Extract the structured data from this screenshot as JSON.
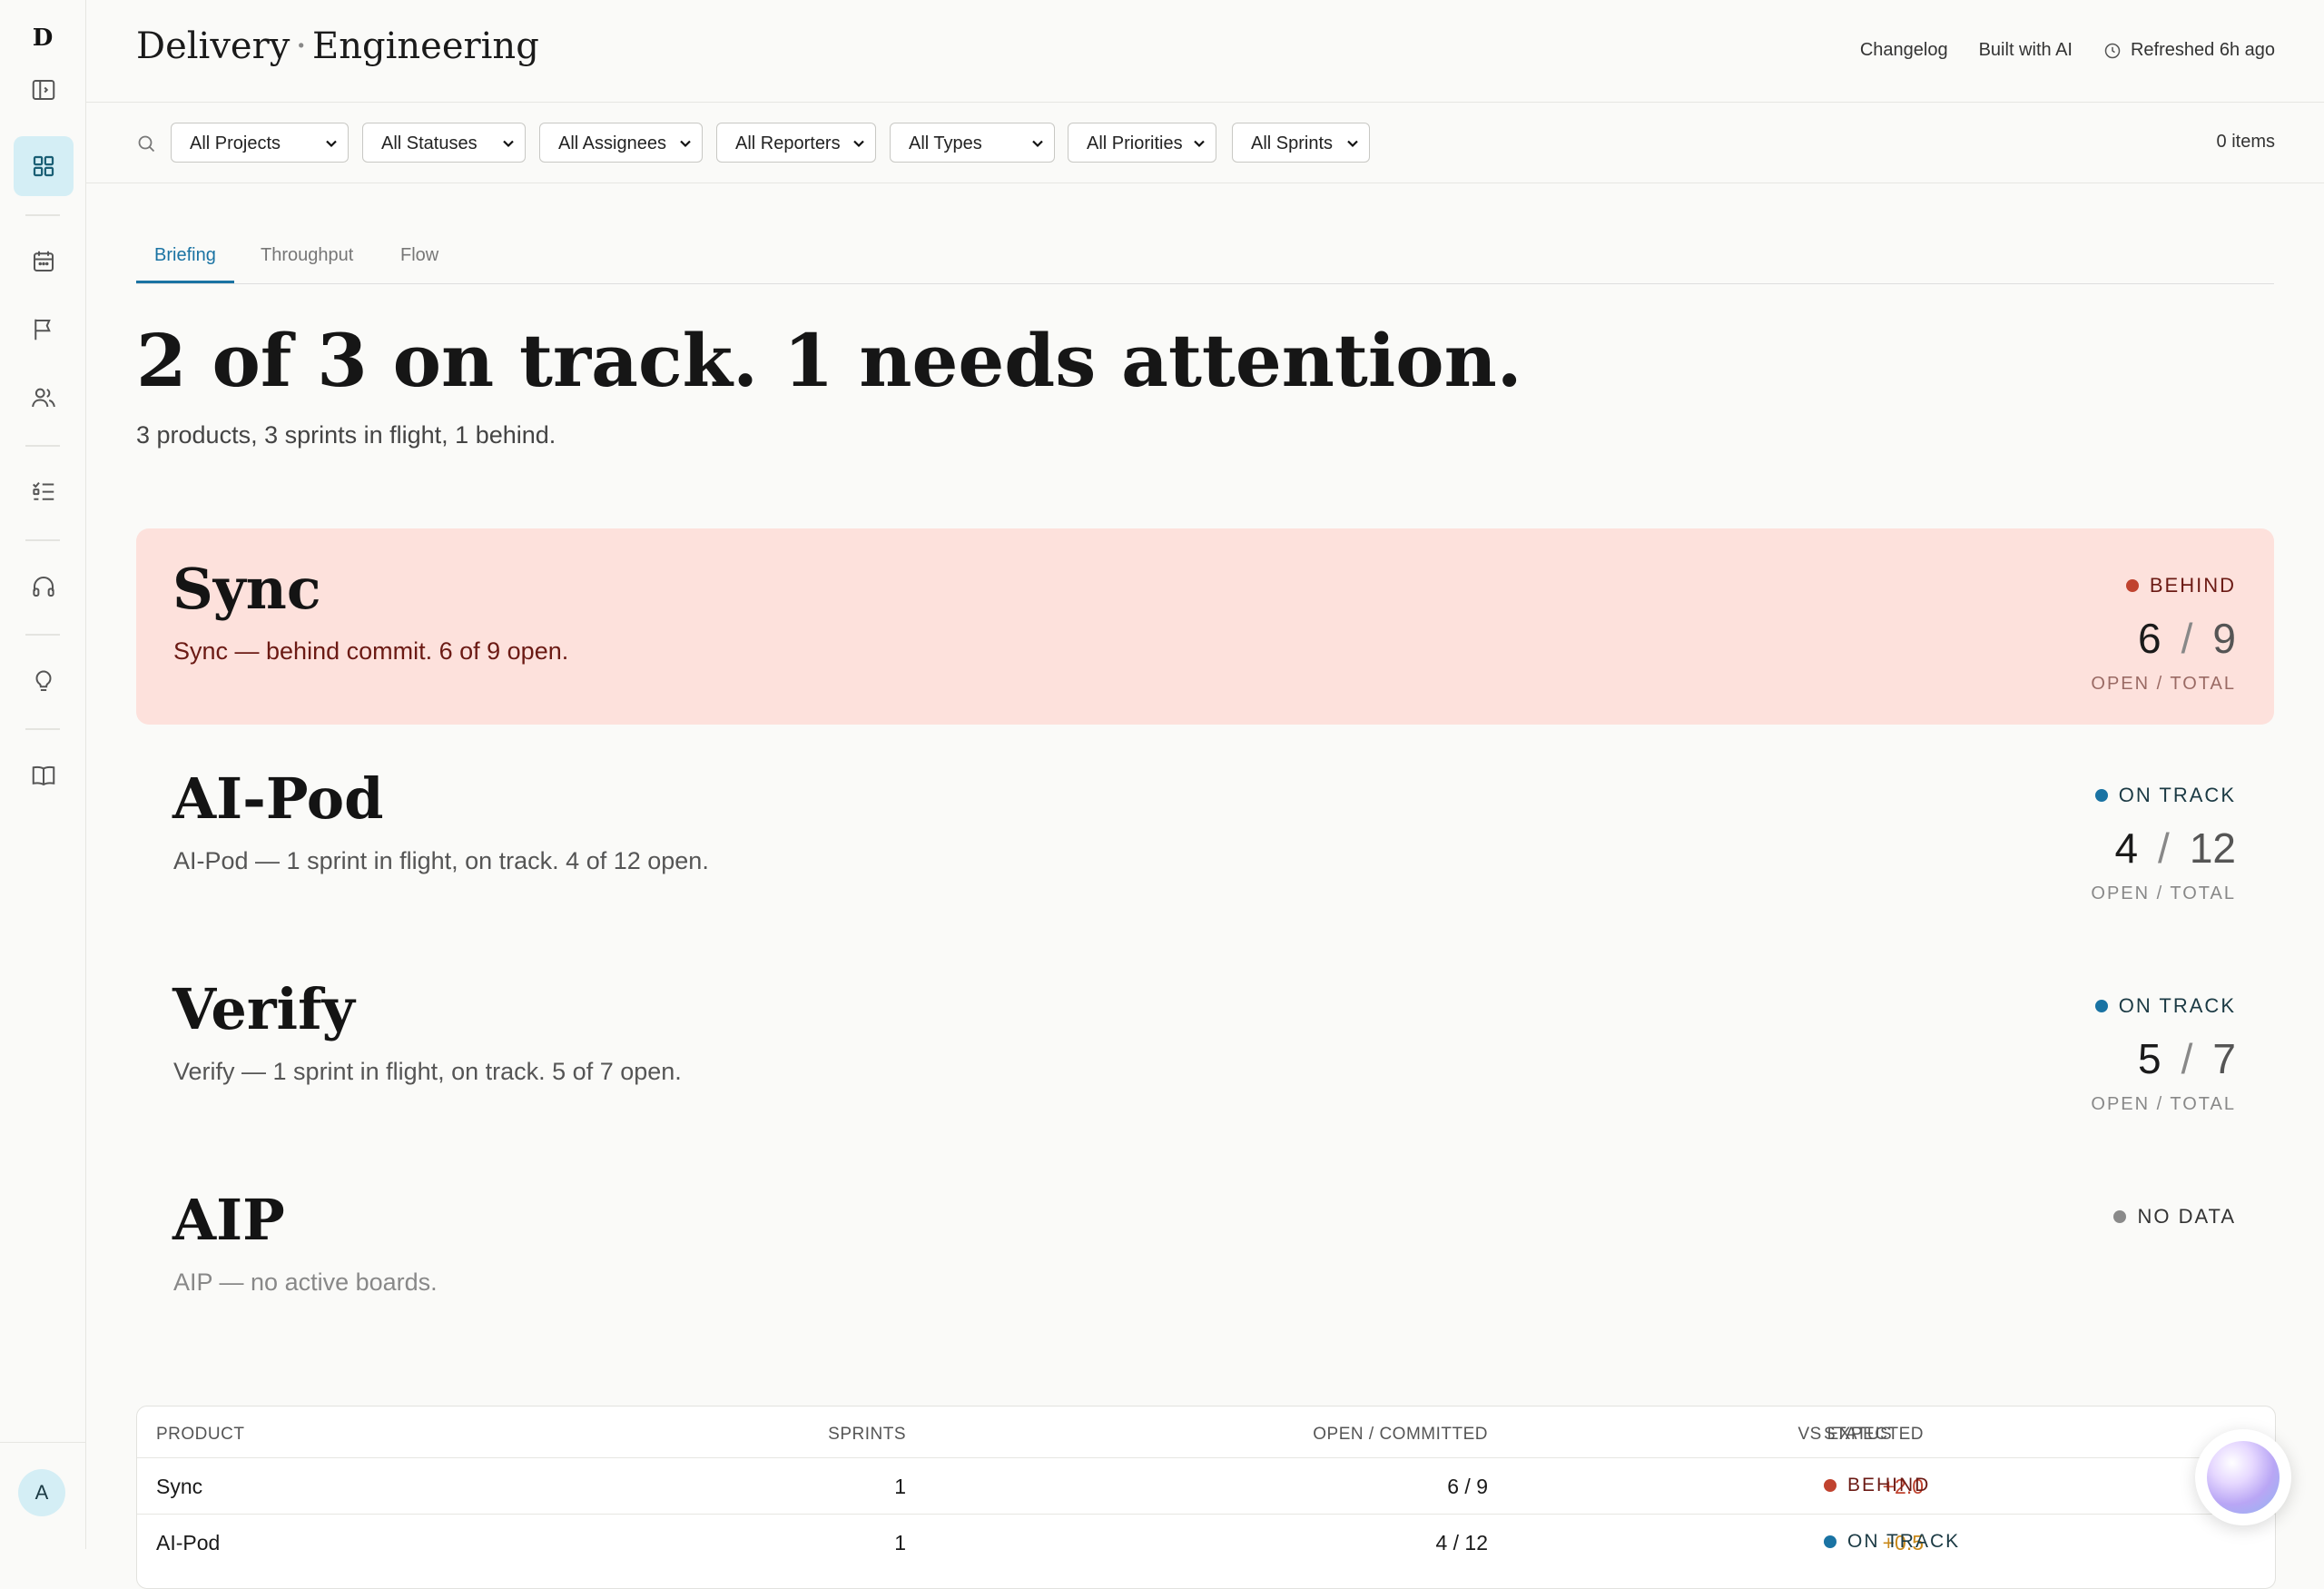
{
  "app": {
    "logo_letter": "D",
    "title_left": "Delivery",
    "title_sep": "·",
    "title_right": "Engineering",
    "avatar_letter": "A"
  },
  "header": {
    "changelog": "Changelog",
    "built_with": "Built with AI",
    "refreshed": "Refreshed 6h ago"
  },
  "sidebar": {
    "items": [
      {
        "icon": "panel-toggle-icon"
      },
      {
        "icon": "dashboard-grid-icon",
        "active": true
      },
      {
        "icon": "calendar-icon"
      },
      {
        "icon": "flag-icon"
      },
      {
        "icon": "users-icon"
      },
      {
        "icon": "checklist-icon"
      },
      {
        "icon": "headphones-icon"
      },
      {
        "icon": "lightbulb-icon"
      },
      {
        "icon": "book-icon"
      }
    ]
  },
  "filters": {
    "selects": [
      "All Projects",
      "All Statuses",
      "All Assignees",
      "All Reporters",
      "All Types",
      "All Priorities",
      "All Sprints"
    ],
    "items_count": "0 items"
  },
  "tabs": [
    "Briefing",
    "Throughput",
    "Flow"
  ],
  "active_tab": "Briefing",
  "summary": {
    "headline": "2 of 3 on track. 1 needs attention.",
    "subline": "3 products, 3 sprints in flight, 1 behind."
  },
  "products": [
    {
      "name": "Sync",
      "desc": "Sync — behind commit. 6 of 9 open.",
      "status": "BEHIND",
      "status_color": "#c0432f",
      "open": "6",
      "total": "9",
      "label": "OPEN / TOTAL"
    },
    {
      "name": "AI-Pod",
      "desc": "AI-Pod — 1 sprint in flight, on track. 4 of 12 open.",
      "status": "ON TRACK",
      "status_color": "#1a73a3",
      "open": "4",
      "total": "12",
      "label": "OPEN / TOTAL"
    },
    {
      "name": "Verify",
      "desc": "Verify — 1 sprint in flight, on track. 5 of 7 open.",
      "status": "ON TRACK",
      "status_color": "#1a73a3",
      "open": "5",
      "total": "7",
      "label": "OPEN / TOTAL"
    },
    {
      "name": "AIP",
      "desc": "AIP — no active boards.",
      "status": "NO DATA",
      "status_color": "#8a8a8a"
    }
  ],
  "table": {
    "headers": {
      "product": "PRODUCT",
      "sprints": "SPRINTS",
      "open_committed": "OPEN / COMMITTED",
      "vs_expected": "VS EXPECTED",
      "status": "STATUS"
    },
    "rows": [
      {
        "product": "Sync",
        "sprints": "1",
        "open_committed": "6 / 9",
        "vs_expected": "+2.0",
        "vs_color": "#c0432f",
        "status": "BEHIND",
        "status_color": "#c0432f"
      },
      {
        "product": "AI-Pod",
        "sprints": "1",
        "open_committed": "4 / 12",
        "vs_expected": "+0.5",
        "vs_color": "#c9891a",
        "status": "ON TRACK",
        "status_color": "#1a73a3"
      }
    ]
  }
}
